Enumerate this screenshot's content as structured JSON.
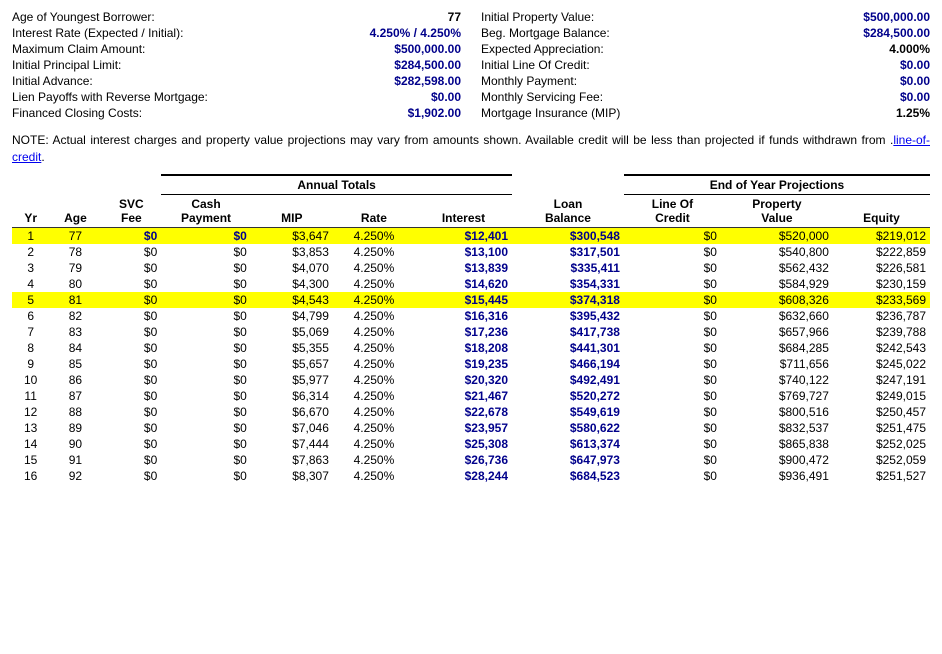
{
  "left_info": [
    {
      "label": "Age of Youngest Borrower:",
      "value": "77",
      "plain": true
    },
    {
      "label": "Interest Rate (Expected / Initial):",
      "value": "4.250%  /  4.250%",
      "plain": false
    },
    {
      "label": "Maximum Claim Amount:",
      "value": "$500,000.00"
    },
    {
      "label": "Initial Principal Limit:",
      "value": "$284,500.00"
    },
    {
      "label": "Initial Advance:",
      "value": "$282,598.00"
    },
    {
      "label": "Lien Payoffs with Reverse Mortgage:",
      "value": "$0.00"
    },
    {
      "label": "Financed Closing Costs:",
      "value": "$1,902.00"
    }
  ],
  "right_info": [
    {
      "label": "Initial Property Value:",
      "value": "$500,000.00"
    },
    {
      "label": "Beg. Mortgage Balance:",
      "value": "$284,500.00"
    },
    {
      "label": "Expected Appreciation:",
      "value": "4.000%",
      "plain": true
    },
    {
      "label": "Initial Line Of Credit:",
      "value": "$0.00"
    },
    {
      "label": "Monthly Payment:",
      "value": "$0.00"
    },
    {
      "label": "Monthly Servicing Fee:",
      "value": "$0.00"
    },
    {
      "label": "Mortgage Insurance (MIP)",
      "value": "1.25%",
      "plain": true
    }
  ],
  "note": "NOTE:  Actual interest charges and property value projections may vary from amounts shown.  Available credit will be less than projected if funds withdrawn from line-of-credit.",
  "table": {
    "annual_group_label": "Annual Totals",
    "eoy_group_label": "End of Year Projections",
    "columns": [
      "Yr",
      "Age",
      "SVC Fee",
      "Cash Payment",
      "MIP",
      "Rate",
      "Interest",
      "Loan Balance",
      "Line Of Credit",
      "Property Value",
      "Equity"
    ],
    "rows": [
      {
        "yr": 1,
        "age": 77,
        "svc": "$0",
        "cash": "$0",
        "mip": "$3,647",
        "rate": "4.250%",
        "interest": "$12,401",
        "loan": "$300,548",
        "loc": "$0",
        "prop": "$520,000",
        "equity": "$219,012",
        "highlight": true
      },
      {
        "yr": 2,
        "age": 78,
        "svc": "$0",
        "cash": "$0",
        "mip": "$3,853",
        "rate": "4.250%",
        "interest": "$13,100",
        "loan": "$317,501",
        "loc": "$0",
        "prop": "$540,800",
        "equity": "$222,859",
        "highlight": false
      },
      {
        "yr": 3,
        "age": 79,
        "svc": "$0",
        "cash": "$0",
        "mip": "$4,070",
        "rate": "4.250%",
        "interest": "$13,839",
        "loan": "$335,411",
        "loc": "$0",
        "prop": "$562,432",
        "equity": "$226,581",
        "highlight": false
      },
      {
        "yr": 4,
        "age": 80,
        "svc": "$0",
        "cash": "$0",
        "mip": "$4,300",
        "rate": "4.250%",
        "interest": "$14,620",
        "loan": "$354,331",
        "loc": "$0",
        "prop": "$584,929",
        "equity": "$230,159",
        "highlight": false
      },
      {
        "yr": 5,
        "age": 81,
        "svc": "$0",
        "cash": "$0",
        "mip": "$4,543",
        "rate": "4.250%",
        "interest": "$15,445",
        "loan": "$374,318",
        "loc": "$0",
        "prop": "$608,326",
        "equity": "$233,569",
        "highlight": true
      },
      {
        "yr": 6,
        "age": 82,
        "svc": "$0",
        "cash": "$0",
        "mip": "$4,799",
        "rate": "4.250%",
        "interest": "$16,316",
        "loan": "$395,432",
        "loc": "$0",
        "prop": "$632,660",
        "equity": "$236,787",
        "highlight": false
      },
      {
        "yr": 7,
        "age": 83,
        "svc": "$0",
        "cash": "$0",
        "mip": "$5,069",
        "rate": "4.250%",
        "interest": "$17,236",
        "loan": "$417,738",
        "loc": "$0",
        "prop": "$657,966",
        "equity": "$239,788",
        "highlight": false
      },
      {
        "yr": 8,
        "age": 84,
        "svc": "$0",
        "cash": "$0",
        "mip": "$5,355",
        "rate": "4.250%",
        "interest": "$18,208",
        "loan": "$441,301",
        "loc": "$0",
        "prop": "$684,285",
        "equity": "$242,543",
        "highlight": false
      },
      {
        "yr": 9,
        "age": 85,
        "svc": "$0",
        "cash": "$0",
        "mip": "$5,657",
        "rate": "4.250%",
        "interest": "$19,235",
        "loan": "$466,194",
        "loc": "$0",
        "prop": "$711,656",
        "equity": "$245,022",
        "highlight": false
      },
      {
        "yr": 10,
        "age": 86,
        "svc": "$0",
        "cash": "$0",
        "mip": "$5,977",
        "rate": "4.250%",
        "interest": "$20,320",
        "loan": "$492,491",
        "loc": "$0",
        "prop": "$740,122",
        "equity": "$247,191",
        "highlight": false
      },
      {
        "yr": 11,
        "age": 87,
        "svc": "$0",
        "cash": "$0",
        "mip": "$6,314",
        "rate": "4.250%",
        "interest": "$21,467",
        "loan": "$520,272",
        "loc": "$0",
        "prop": "$769,727",
        "equity": "$249,015",
        "highlight": false
      },
      {
        "yr": 12,
        "age": 88,
        "svc": "$0",
        "cash": "$0",
        "mip": "$6,670",
        "rate": "4.250%",
        "interest": "$22,678",
        "loan": "$549,619",
        "loc": "$0",
        "prop": "$800,516",
        "equity": "$250,457",
        "highlight": false
      },
      {
        "yr": 13,
        "age": 89,
        "svc": "$0",
        "cash": "$0",
        "mip": "$7,046",
        "rate": "4.250%",
        "interest": "$23,957",
        "loan": "$580,622",
        "loc": "$0",
        "prop": "$832,537",
        "equity": "$251,475",
        "highlight": false
      },
      {
        "yr": 14,
        "age": 90,
        "svc": "$0",
        "cash": "$0",
        "mip": "$7,444",
        "rate": "4.250%",
        "interest": "$25,308",
        "loan": "$613,374",
        "loc": "$0",
        "prop": "$865,838",
        "equity": "$252,025",
        "highlight": false
      },
      {
        "yr": 15,
        "age": 91,
        "svc": "$0",
        "cash": "$0",
        "mip": "$7,863",
        "rate": "4.250%",
        "interest": "$26,736",
        "loan": "$647,973",
        "loc": "$0",
        "prop": "$900,472",
        "equity": "$252,059",
        "highlight": false
      },
      {
        "yr": 16,
        "age": 92,
        "svc": "$0",
        "cash": "$0",
        "mip": "$8,307",
        "rate": "4.250%",
        "interest": "$28,244",
        "loan": "$684,523",
        "loc": "$0",
        "prop": "$936,491",
        "equity": "$251,527",
        "highlight": false
      }
    ]
  }
}
